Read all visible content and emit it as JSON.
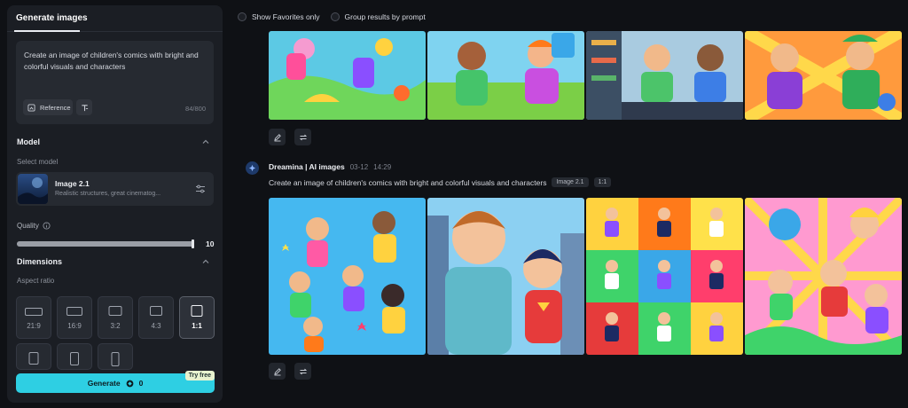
{
  "panel": {
    "tab_label": "Generate images",
    "prompt_text": "Create an image of children's comics with bright and colorful visuals and characters",
    "reference_label": "Reference",
    "char_count": "84/800",
    "model_section_title": "Model",
    "select_model_label": "Select model",
    "model_name": "Image 2.1",
    "model_description": "Realistic structures, great cinematog...",
    "quality_label": "Quality",
    "quality_value": "10",
    "quality_fraction": 1.0,
    "dimensions_title": "Dimensions",
    "aspect_ratio_label": "Aspect ratio",
    "aspect_ratios": [
      "21:9",
      "16:9",
      "3:2",
      "4:3",
      "1:1"
    ],
    "selected_ratio": "1:1",
    "generate_label": "Generate",
    "credit_value": "0",
    "try_free_label": "Try free"
  },
  "filters": {
    "favorites_label": "Show Favorites only",
    "group_label": "Group results by prompt"
  },
  "generation": {
    "source": "Dreamina | AI images",
    "date": "03-12",
    "time": "14:29",
    "prompt": "Create an image of children's comics with bright and colorful visuals and characters",
    "model_tag": "Image 2.1",
    "ratio_tag": "1:1"
  },
  "icons": [
    "reference-icon",
    "text-icon",
    "chevron-up-icon",
    "settings-sliders-icon",
    "info-icon",
    "credit-icon",
    "edit-icon",
    "regenerate-icon",
    "dreamina-logo-icon"
  ],
  "colors": {
    "accent": "#2ecfe3",
    "background": "#0f1115",
    "panel": "#1b1e24"
  }
}
